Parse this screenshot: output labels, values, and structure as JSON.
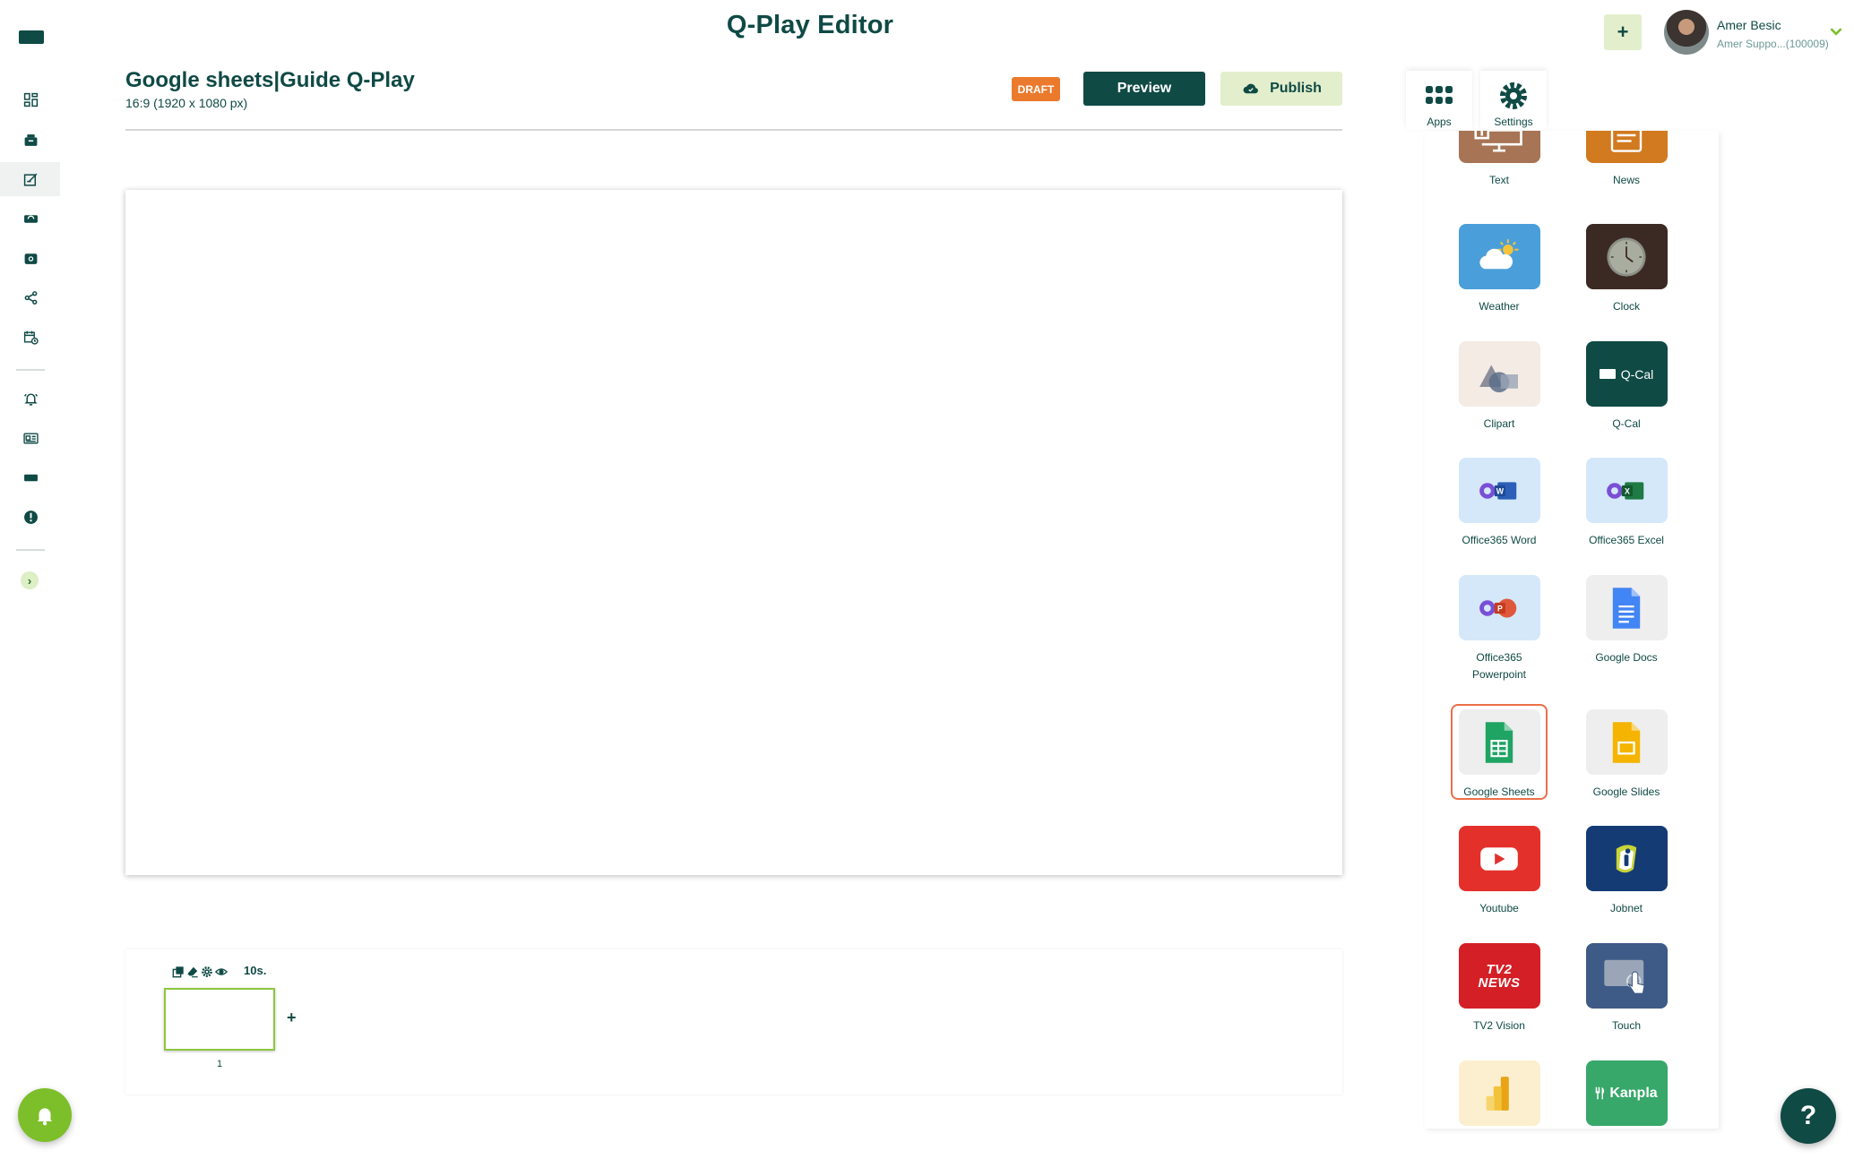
{
  "header": {
    "title": "Q-Play Editor",
    "add_label": "+",
    "user_name": "Amer Besic",
    "user_sub": "Amer Suppo...(100009)"
  },
  "document": {
    "title": "Google sheets|Guide Q-Play",
    "resolution": "16:9 (1920 x 1080 px)",
    "status": "DRAFT",
    "preview_label": "Preview",
    "publish_label": "Publish"
  },
  "timeline": {
    "duration": "10s.",
    "slide_number": "1",
    "add_label": "+"
  },
  "panel": {
    "tabs": [
      {
        "label": "Apps",
        "icon": "grid-icon"
      },
      {
        "label": "Settings",
        "icon": "gear-icon"
      }
    ],
    "apps": [
      {
        "label": "Text",
        "icon": "text-icon"
      },
      {
        "label": "News",
        "icon": "news-icon"
      },
      {
        "label": "Weather",
        "icon": "weather-icon"
      },
      {
        "label": "Clock",
        "icon": "clock-icon"
      },
      {
        "label": "Clipart",
        "icon": "clipart-icon"
      },
      {
        "label": "Q-Cal",
        "icon": "qcal-icon",
        "tile_text": "Q-Cal"
      },
      {
        "label": "Office365 Word",
        "icon": "word-icon"
      },
      {
        "label": "Office365 Excel",
        "icon": "excel-icon"
      },
      {
        "label": "Office365 Powerpoint",
        "icon": "powerpoint-icon"
      },
      {
        "label": "Google Docs",
        "icon": "google-docs-icon"
      },
      {
        "label": "Google Sheets",
        "icon": "google-sheets-icon"
      },
      {
        "label": "Google Slides",
        "icon": "google-slides-icon"
      },
      {
        "label": "Youtube",
        "icon": "youtube-icon"
      },
      {
        "label": "Jobnet",
        "icon": "jobnet-icon"
      },
      {
        "label": "TV2 Vision",
        "icon": "tv2-icon",
        "tile_text": "TV2 NEWS"
      },
      {
        "label": "Touch",
        "icon": "touch-icon"
      },
      {
        "label": "",
        "icon": "powerbi-icon"
      },
      {
        "label": "",
        "icon": "kanpla-icon",
        "tile_text": "Kanpla"
      }
    ]
  },
  "help_label": "?",
  "colors": {
    "primary": "#0f4a45",
    "accent_green": "#8cc63f",
    "light_green": "#e3efcc",
    "draft": "#ec7a2d",
    "selection": "#ec6f48"
  }
}
